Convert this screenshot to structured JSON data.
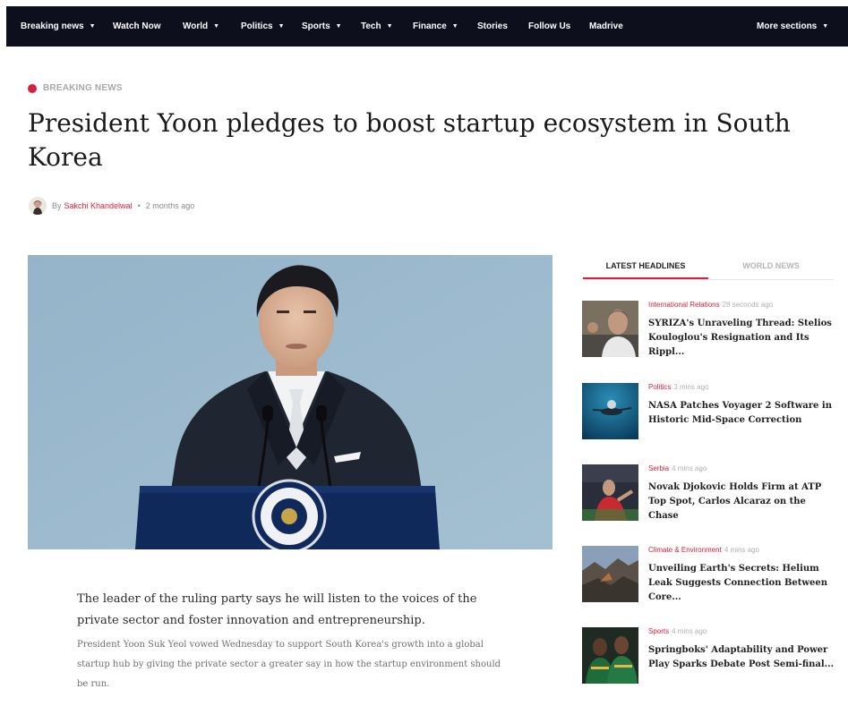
{
  "nav": {
    "items": [
      {
        "label": "Breaking news",
        "caret": true
      },
      {
        "label": "Watch Now",
        "caret": false
      },
      {
        "label": "World",
        "caret": true
      },
      {
        "label": "Politics",
        "caret": true
      },
      {
        "label": "Sports",
        "caret": true
      },
      {
        "label": "Tech",
        "caret": true
      },
      {
        "label": "Finance",
        "caret": true
      },
      {
        "label": "Stories",
        "caret": false
      },
      {
        "label": "Follow Us",
        "caret": false
      },
      {
        "label": "Madrive",
        "caret": false
      }
    ],
    "more_label": "More sections",
    "caret_glyph": "▼"
  },
  "article": {
    "category": "BREAKING NEWS",
    "title": "President Yoon pledges to boost startup ecosystem in South Korea",
    "byline_prefix": "By",
    "author": "Sakchi Khandelwal",
    "separator": "•",
    "time": "2 months ago",
    "lede": "The leader of the ruling party says he will listen to the voices of the private sector and foster innovation and entrepreneurship.",
    "body": "President Yoon Suk Yeol vowed Wednesday to support South Korea's growth into a global startup hub by giving the private sector a greater say in how the startup environment should be run."
  },
  "sidebar": {
    "tabs": [
      {
        "label": "LATEST HEADLINES"
      },
      {
        "label": "WORLD NEWS"
      }
    ],
    "items": [
      {
        "category": "International Relations",
        "time": "28 seconds ago",
        "title": "SYRIZA's Unraveling Thread: Stelios Kouloglou's Resignation and Its Rippl..."
      },
      {
        "category": "Politics",
        "time": "3 mins ago",
        "title": "NASA Patches Voyager 2 Software in Historic Mid-Space Correction"
      },
      {
        "category": "Serbia",
        "time": "4 mins ago",
        "title": "Novak Djokovic Holds Firm at ATP Top Spot, Carlos Alcaraz on the Chase"
      },
      {
        "category": "Climate & Environment",
        "time": "4 mins ago",
        "title": "Unveiling Earth's Secrets: Helium Leak Suggests Connection Between Core..."
      },
      {
        "category": "Sports",
        "time": "4 mins ago",
        "title": "Springboks' Adaptability and Power Play Sparks Debate Post Semi-final..."
      }
    ]
  },
  "colors": {
    "accent": "#d8203a",
    "nav_bg": "#0d0f1c"
  }
}
